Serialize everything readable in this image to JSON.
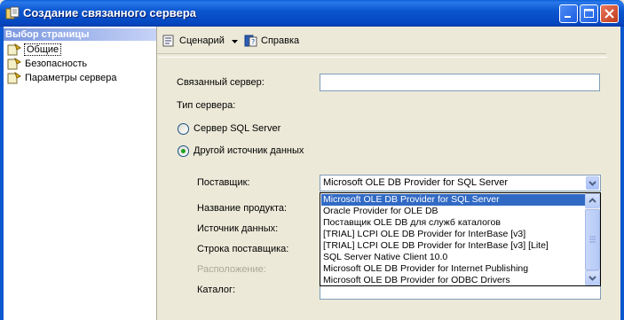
{
  "window": {
    "title": "Создание связанного сервера",
    "colors": {
      "titlebar": "#0b57d0",
      "selection": "#316ac5",
      "dialog_bg": "#ece9d8"
    }
  },
  "sidebar": {
    "header": "Выбор страницы",
    "items": [
      {
        "label": "Общие",
        "icon": "page-icon",
        "selected": true
      },
      {
        "label": "Безопасность",
        "icon": "page-icon",
        "selected": false
      },
      {
        "label": "Параметры сервера",
        "icon": "page-icon",
        "selected": false
      }
    ]
  },
  "toolbar": {
    "script_label": "Сценарий",
    "script_icon": "script-icon",
    "help_label": "Справка",
    "help_icon": "help-icon"
  },
  "form": {
    "linked_server_label": "Связанный сервер:",
    "linked_server_value": "",
    "server_type_label": "Тип сервера:",
    "radio_sql_server_label": "Сервер SQL Server",
    "radio_other_source_label": "Другой источник данных",
    "selected_server_type": "other",
    "provider_label": "Поставщик:",
    "provider_value": "Microsoft OLE DB Provider for SQL Server",
    "product_name_label": "Название продукта:",
    "data_source_label": "Источник данных:",
    "provider_string_label": "Строка поставщика:",
    "location_label": "Расположение:",
    "catalog_label": "Каталог:"
  },
  "provider_dropdown": {
    "options": [
      "Microsoft OLE DB Provider for SQL Server",
      "Oracle Provider for OLE DB",
      "Поставщик OLE DB для служб каталогов",
      "[TRIAL] LCPI OLE DB Provider for InterBase [v3]",
      "[TRIAL] LCPI OLE DB Provider for InterBase [v3] [Lite]",
      "SQL Server Native Client 10.0",
      "Microsoft OLE DB Provider for Internet Publishing",
      "Microsoft OLE DB Provider for ODBC Drivers"
    ],
    "highlighted_index": 0
  }
}
